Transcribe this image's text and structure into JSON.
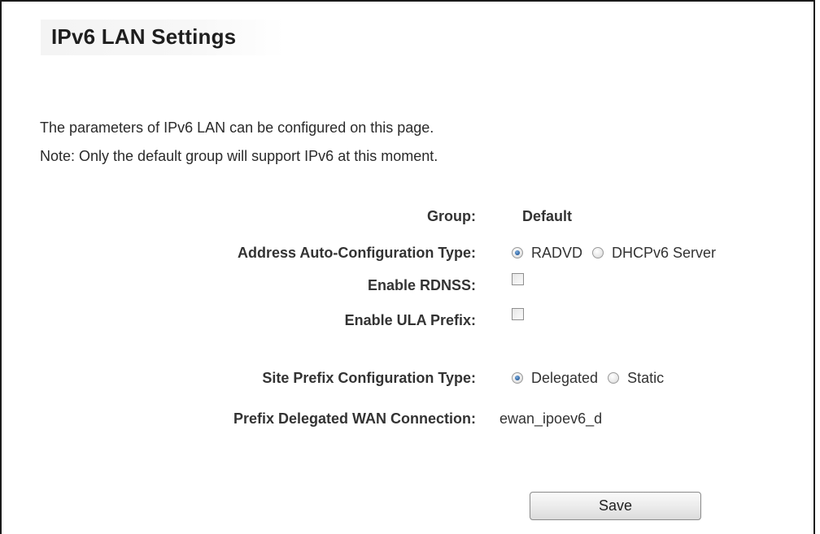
{
  "page": {
    "title": "IPv6 LAN Settings",
    "description_line1": "The parameters of IPv6 LAN can be configured on this page.",
    "description_line2": "Note: Only the default group will support IPv6 at this moment."
  },
  "form": {
    "group": {
      "label": "Group:",
      "value": "Default"
    },
    "address_auto_config": {
      "label": "Address Auto-Configuration Type:",
      "options": [
        {
          "label": "RADVD",
          "selected": true
        },
        {
          "label": "DHCPv6 Server",
          "selected": false
        }
      ]
    },
    "enable_rdnss": {
      "label": "Enable RDNSS:",
      "checked": false
    },
    "enable_ula_prefix": {
      "label": "Enable ULA Prefix:",
      "checked": false
    },
    "site_prefix_config": {
      "label": "Site Prefix Configuration Type:",
      "options": [
        {
          "label": "Delegated",
          "selected": true
        },
        {
          "label": "Static",
          "selected": false
        }
      ]
    },
    "prefix_delegated_wan": {
      "label": "Prefix Delegated WAN Connection:",
      "value": "ewan_ipoev6_d"
    }
  },
  "actions": {
    "save_label": "Save"
  }
}
